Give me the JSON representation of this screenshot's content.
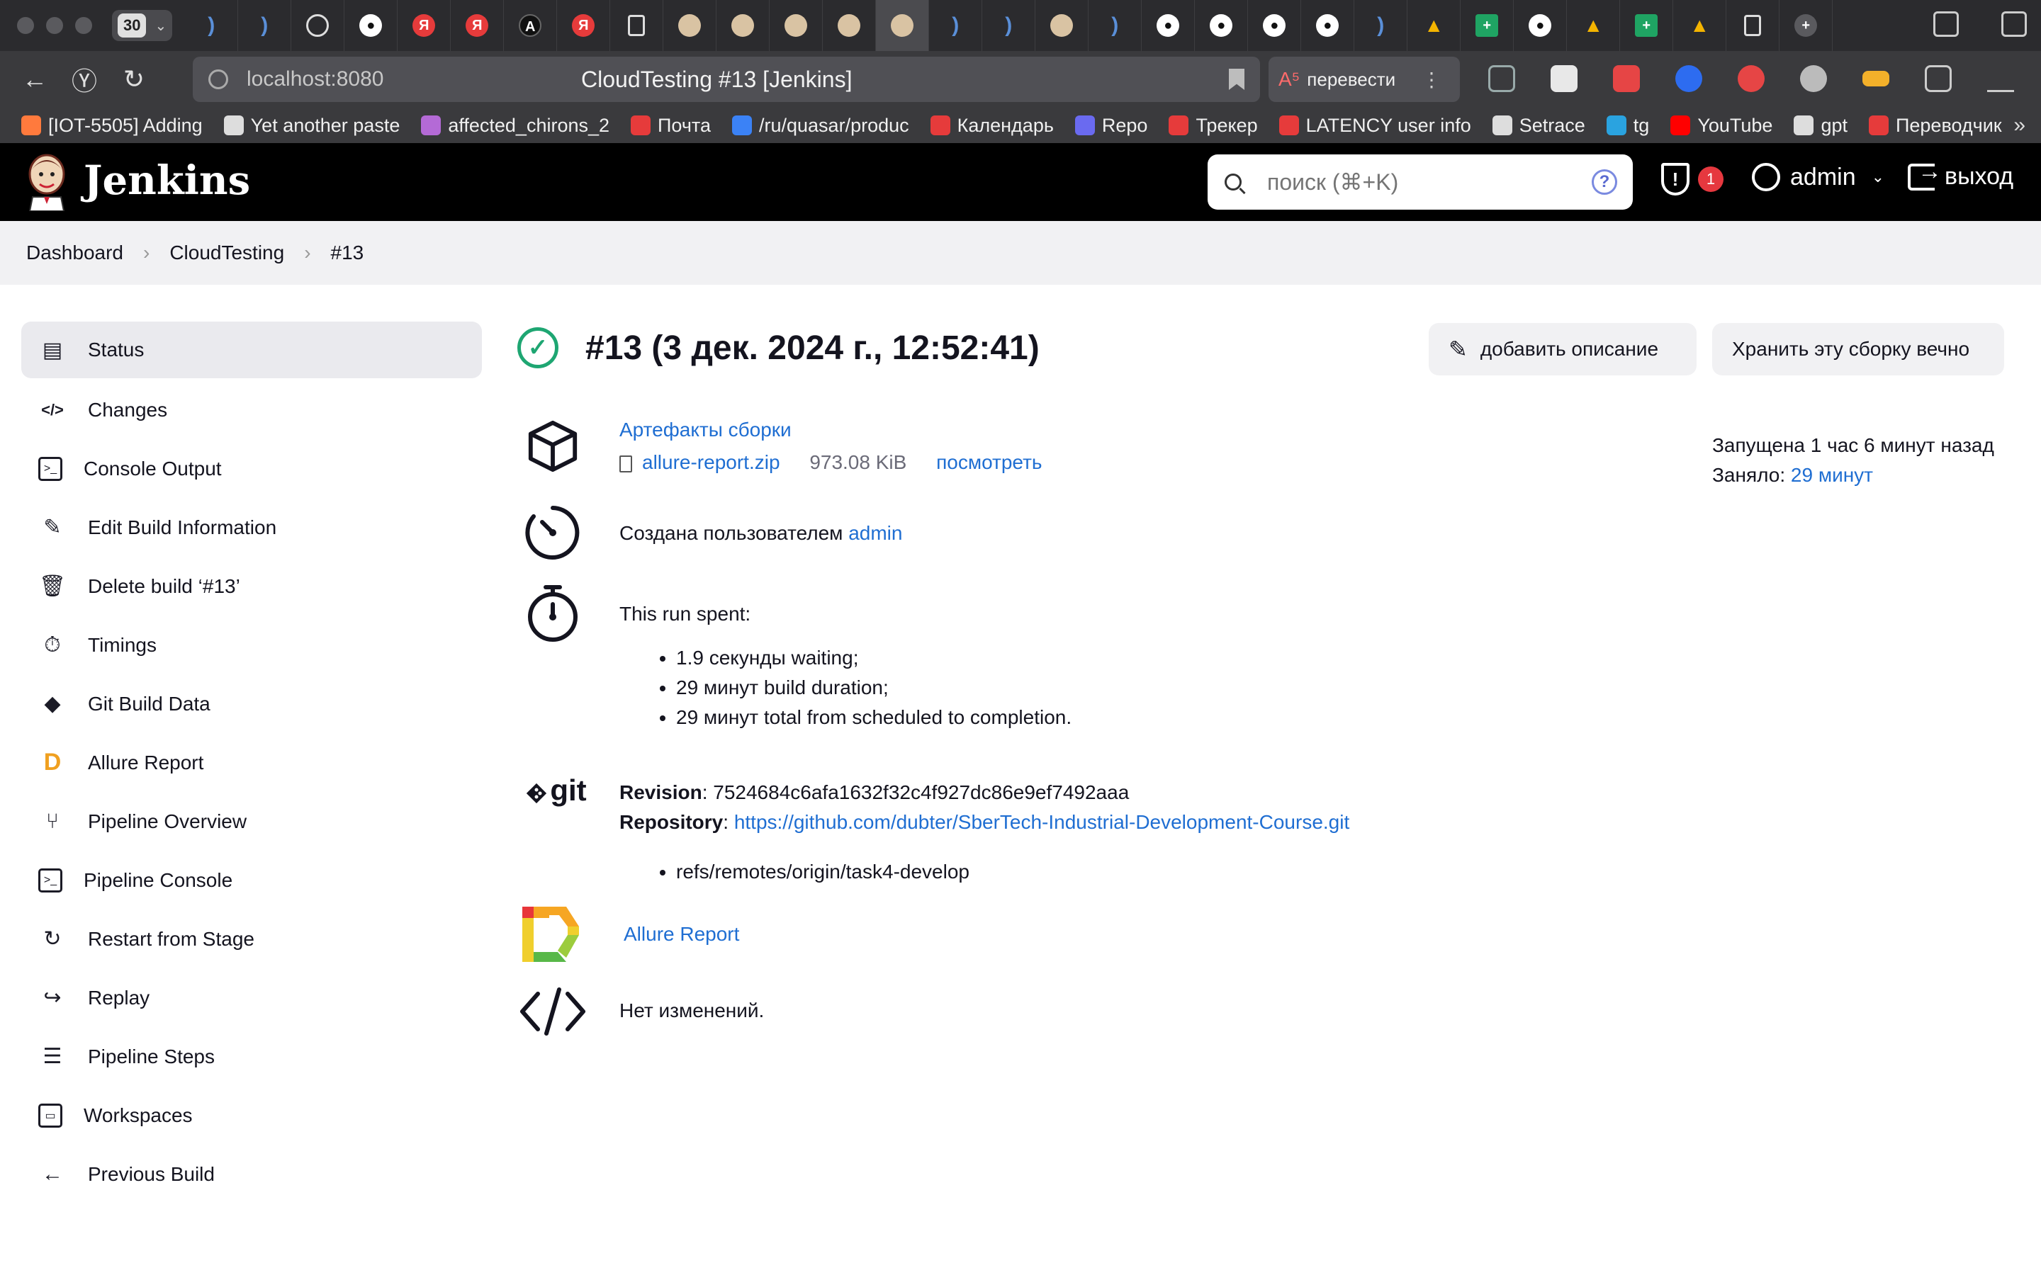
{
  "browser": {
    "tab_count": "30",
    "url_host": "localhost:8080",
    "page_title": "CloudTesting #13 [Jenkins]",
    "translate_label": "перевести",
    "bookmarks": [
      {
        "label": "[IOT-5505] Adding",
        "color": "#ff7a3d"
      },
      {
        "label": "Yet another paste",
        "color": "#dddddd"
      },
      {
        "label": "affected_chirons_2",
        "color": "#b46ad6"
      },
      {
        "label": "Почта",
        "color": "#e63b3b"
      },
      {
        "label": "/ru/quasar/produc",
        "color": "#3b82f6"
      },
      {
        "label": "Календарь",
        "color": "#e63b3b"
      },
      {
        "label": "Repo",
        "color": "#6a6af0"
      },
      {
        "label": "Трекер",
        "color": "#e63b3b"
      },
      {
        "label": "LATENCY user info",
        "color": "#e63b3b"
      },
      {
        "label": "Setrace",
        "color": "#dddddd"
      },
      {
        "label": "tg",
        "color": "#2aa3e0"
      },
      {
        "label": "YouTube",
        "color": "#ff0000"
      },
      {
        "label": "gpt",
        "color": "#dddddd"
      },
      {
        "label": "Переводчик",
        "color": "#e63b3b"
      }
    ]
  },
  "header": {
    "brand": "Jenkins",
    "search_placeholder": "поиск (⌘+K)",
    "alert_count": "1",
    "user": "admin",
    "logout": "выход"
  },
  "breadcrumb": [
    "Dashboard",
    "CloudTesting",
    "#13"
  ],
  "sidebar": [
    {
      "label": "Status",
      "icon": "document-icon",
      "glyph": "▤"
    },
    {
      "label": "Changes",
      "icon": "code-icon",
      "glyph": "</>"
    },
    {
      "label": "Console Output",
      "icon": "terminal-icon",
      "glyph": ">_"
    },
    {
      "label": "Edit Build Information",
      "icon": "edit-icon",
      "glyph": "✎"
    },
    {
      "label": "Delete build ‘#13’",
      "icon": "trash-icon",
      "glyph": "🗑"
    },
    {
      "label": "Timings",
      "icon": "stopwatch-icon",
      "glyph": "⏱"
    },
    {
      "label": "Git Build Data",
      "icon": "git-icon",
      "glyph": "◆"
    },
    {
      "label": "Allure Report",
      "icon": "allure-icon",
      "glyph": "D"
    },
    {
      "label": "Pipeline Overview",
      "icon": "branch-icon",
      "glyph": "⑂"
    },
    {
      "label": "Pipeline Console",
      "icon": "terminal-icon",
      "glyph": ">_"
    },
    {
      "label": "Restart from Stage",
      "icon": "restart-icon",
      "glyph": "↻"
    },
    {
      "label": "Replay",
      "icon": "replay-icon",
      "glyph": "↪"
    },
    {
      "label": "Pipeline Steps",
      "icon": "list-icon",
      "glyph": "☰"
    },
    {
      "label": "Workspaces",
      "icon": "folder-icon",
      "glyph": "▭"
    },
    {
      "label": "Previous Build",
      "icon": "arrow-left-icon",
      "glyph": "←"
    }
  ],
  "build": {
    "title": "#13 (3 дек. 2024 г., 12:52:41)",
    "add_description": "добавить описание",
    "keep_forever": "Хранить эту сборку вечно",
    "started": "Запущена 1 час 6 минут назад",
    "took_label": "Заняло:",
    "took_value": "29 минут",
    "artifacts_title": "Артефакты сборки",
    "artifact_name": "allure-report.zip",
    "artifact_size": "973.08 KiB",
    "artifact_view": "посмотреть",
    "created_by": "Создана пользователем",
    "created_user": "admin",
    "run_spent": "This run spent:",
    "timings": [
      "1.9 секунды waiting;",
      "29 минут build duration;",
      "29 минут total from scheduled to completion."
    ],
    "revision_label": "Revision",
    "revision": "7524684c6afa1632f32c4f927dc86e9ef7492aaa",
    "repository_label": "Repository",
    "repository": "https://github.com/dubter/SberTech-Industrial-Development-Course.git",
    "refs": [
      "refs/remotes/origin/task4-develop"
    ],
    "git_logo_text": "git",
    "allure_link": "Allure Report",
    "no_changes": "Нет изменений."
  },
  "colors": {
    "success": "#1ea672",
    "link": "#1f6ed2",
    "alert": "#e6383f"
  }
}
